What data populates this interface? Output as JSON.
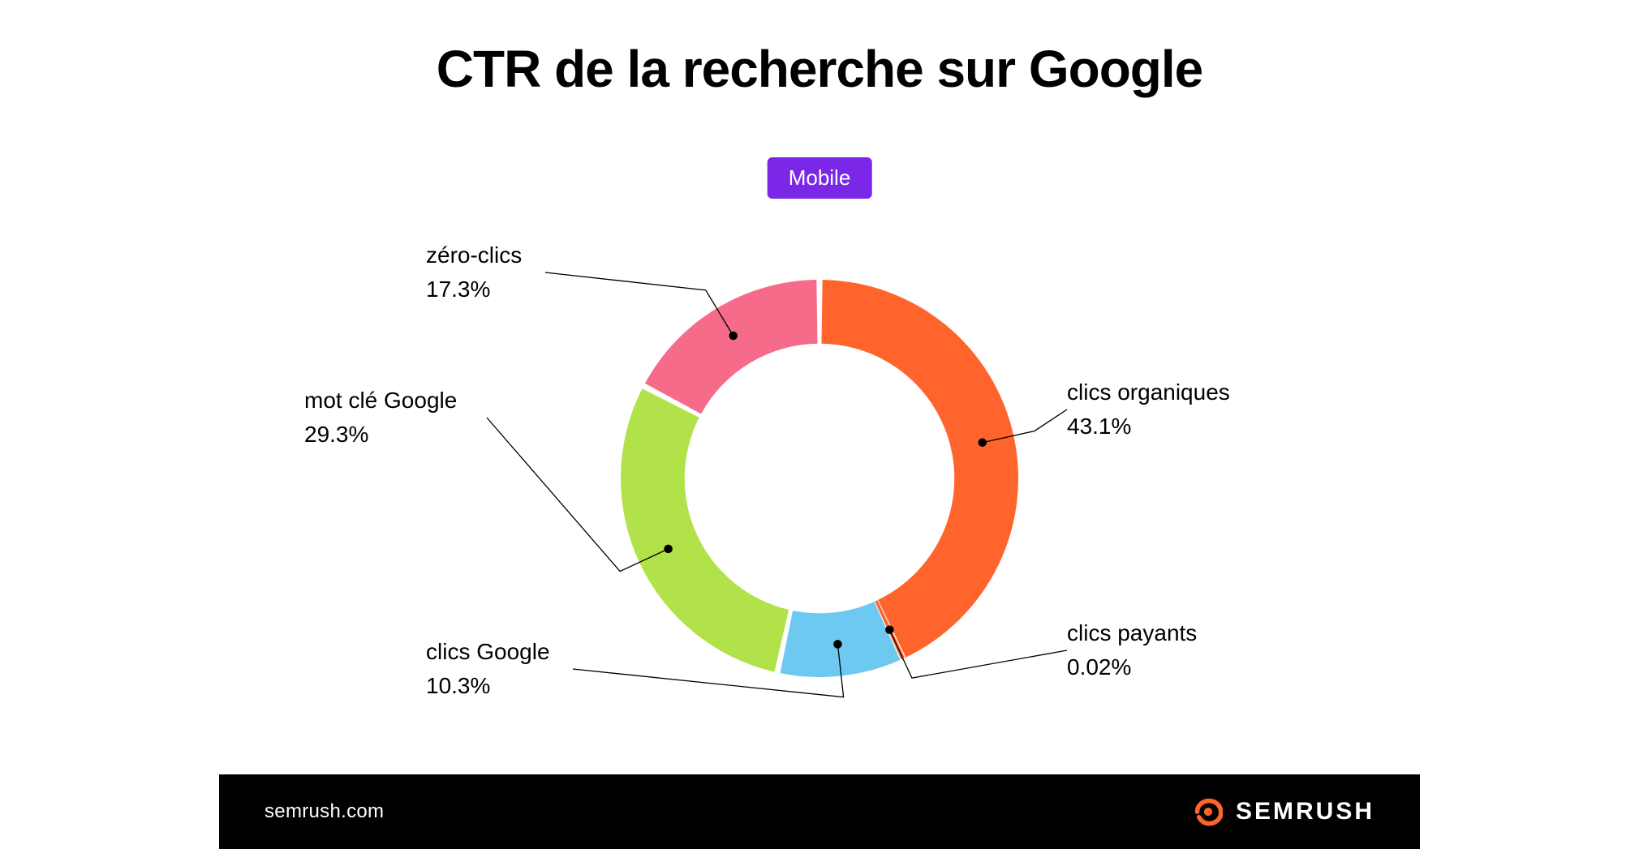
{
  "title": "CTR de la recherche sur Google",
  "badge": "Mobile",
  "footer": {
    "site": "semrush.com",
    "brand": "SEMRUSH"
  },
  "chart_data": {
    "type": "pie",
    "title": "CTR de la recherche sur Google",
    "series": [
      {
        "name": "clics organiques",
        "value": 43.1,
        "value_label": "43.1%",
        "color": "#ff642d"
      },
      {
        "name": "clics payants",
        "value": 0.02,
        "value_label": "0.02%",
        "color": "#ff642d"
      },
      {
        "name": "clics Google",
        "value": 10.3,
        "value_label": "10.3%",
        "color": "#6ec9f0"
      },
      {
        "name": "mot clé Google",
        "value": 29.3,
        "value_label": "29.3%",
        "color": "#b2e24a"
      },
      {
        "name": "zéro-clics",
        "value": 17.3,
        "value_label": "17.3%",
        "color": "#f76b8a"
      }
    ]
  },
  "labels": {
    "organic": {
      "name": "clics organiques",
      "pct": "43.1%"
    },
    "paid": {
      "name": "clics payants",
      "pct": "0.02%"
    },
    "google": {
      "name": "clics Google",
      "pct": "10.3%"
    },
    "keyword": {
      "name": "mot clé Google",
      "pct": "29.3%"
    },
    "zero": {
      "name": "zéro-clics",
      "pct": "17.3%"
    }
  }
}
